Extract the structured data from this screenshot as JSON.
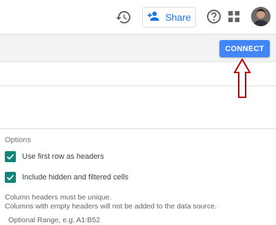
{
  "header": {
    "share_label": "Share",
    "icons": [
      "history-icon",
      "add-person-icon",
      "help-icon",
      "apps-grid-icon",
      "avatar"
    ]
  },
  "toolbar": {
    "connect_label": "CONNECT"
  },
  "options": {
    "title": "Options",
    "first_row_headers": {
      "label": "Use first row as headers",
      "checked": true
    },
    "include_hidden": {
      "label": "Include hidden and filtered cells",
      "checked": true
    },
    "note_line1": "Column headers must be unique.",
    "note_line2": "Columns with empty headers will not be added to the data source.",
    "range_placeholder": "Optional Range, e.g. A1:B52"
  },
  "colors": {
    "connect": "#4285f4",
    "share_text": "#1a73e8",
    "checkbox": "#12857a",
    "arrow": "#c00000"
  }
}
